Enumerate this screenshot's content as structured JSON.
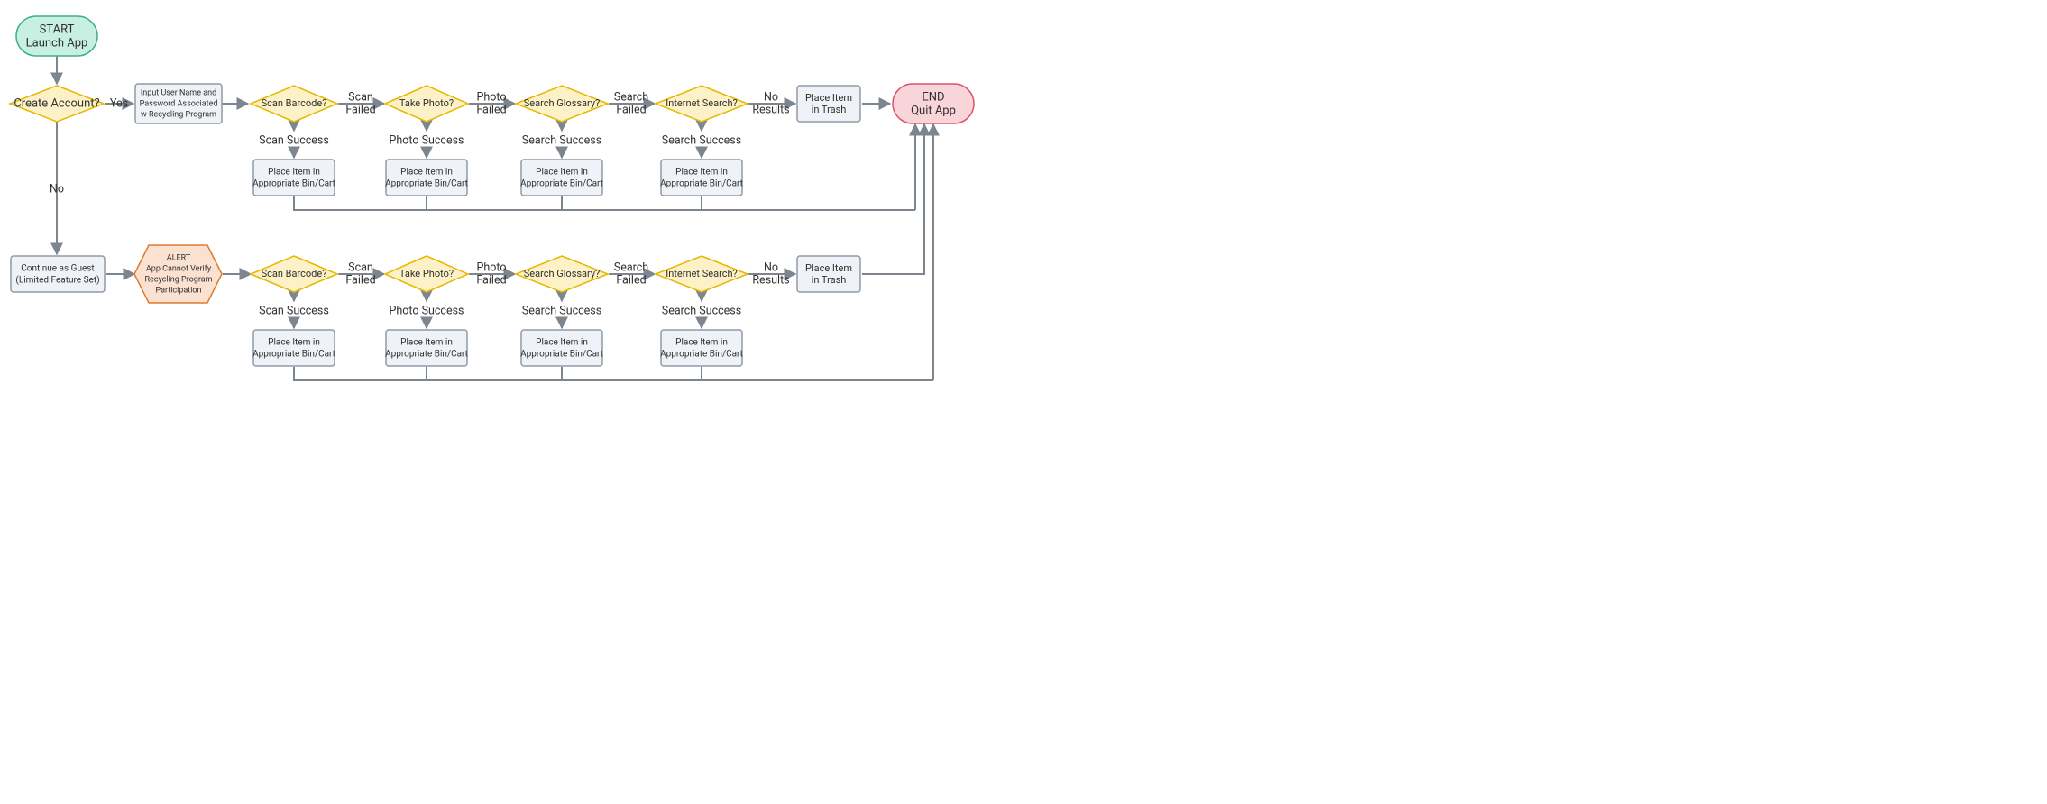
{
  "nodes": {
    "start": {
      "line1": "START",
      "line2": "Launch App"
    },
    "createAccount": {
      "label": "Create Account?"
    },
    "inputCreds": {
      "line1": "Input User Name and",
      "line2": "Password Associated",
      "line3": "w Recycling Program"
    },
    "scanBarcode": {
      "label": "Scan Barcode?"
    },
    "takePhoto": {
      "label": "Take Photo?"
    },
    "searchGlossary": {
      "label": "Search Glossary?"
    },
    "internetSearch": {
      "label": "Internet Search?"
    },
    "placeBin": {
      "line1": "Place Item in",
      "line2": "Appropriate Bin/Cart"
    },
    "placeTrash": {
      "line1": "Place Item",
      "line2": "in Trash"
    },
    "end": {
      "line1": "END",
      "line2": "Quit App"
    },
    "guest": {
      "line1": "Continue as Guest",
      "line2": "(Limited Feature Set)"
    },
    "alert": {
      "line1": "ALERT",
      "line2": "App Cannot Verify",
      "line3": "Recycling Program",
      "line4": "Participation"
    }
  },
  "edges": {
    "yes": "Yes",
    "no": "No",
    "scanFailed": {
      "line1": "Scan",
      "line2": "Failed"
    },
    "photoFailed": {
      "line1": "Photo",
      "line2": "Failed"
    },
    "searchFailed": {
      "line1": "Search",
      "line2": "Failed"
    },
    "noResults": {
      "line1": "No",
      "line2": "Results"
    },
    "scanSuccess": "Scan Success",
    "photoSuccess": "Photo Success",
    "searchSuccess": "Search Success"
  }
}
